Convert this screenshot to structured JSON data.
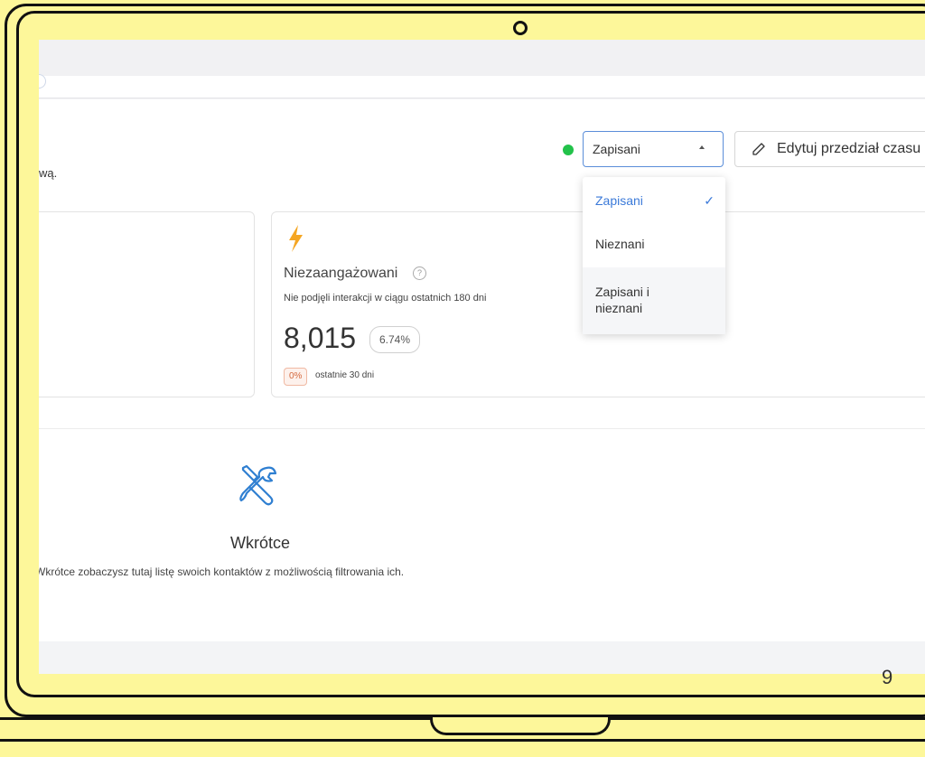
{
  "header": {
    "subtitle": "wą."
  },
  "filter": {
    "selected": "Zapisani",
    "status_color": "#22c24a",
    "options": [
      {
        "label": "Zapisani",
        "selected": true
      },
      {
        "label": "Nieznani",
        "selected": false
      },
      {
        "label": "Zapisani i nieznani",
        "selected": false
      }
    ],
    "check_mark": "✓"
  },
  "toolbar": {
    "edit_label": "Edytuj przedział czasu"
  },
  "card": {
    "icon": "lightning-icon",
    "title": "Niezaangażowani",
    "help_icon": "?",
    "description": "Nie podjęli interakcji w ciągu ostatnich 180 dni",
    "value": "8,015",
    "percent": "6.74%",
    "delta": "0%",
    "delta_period": "ostatnie 30 dni"
  },
  "coming_soon": {
    "icon": "tools-icon",
    "title": "Wkrótce",
    "description": "Wkrótce zobaczysz tutaj listę swoich kontaktów z możliwością filtrowania ich."
  },
  "slide": {
    "page_number": "9"
  },
  "colors": {
    "background": "#fdf79a",
    "accent": "#3b7ad9",
    "bolt": "#f5a623",
    "delta": "#d4693e"
  }
}
